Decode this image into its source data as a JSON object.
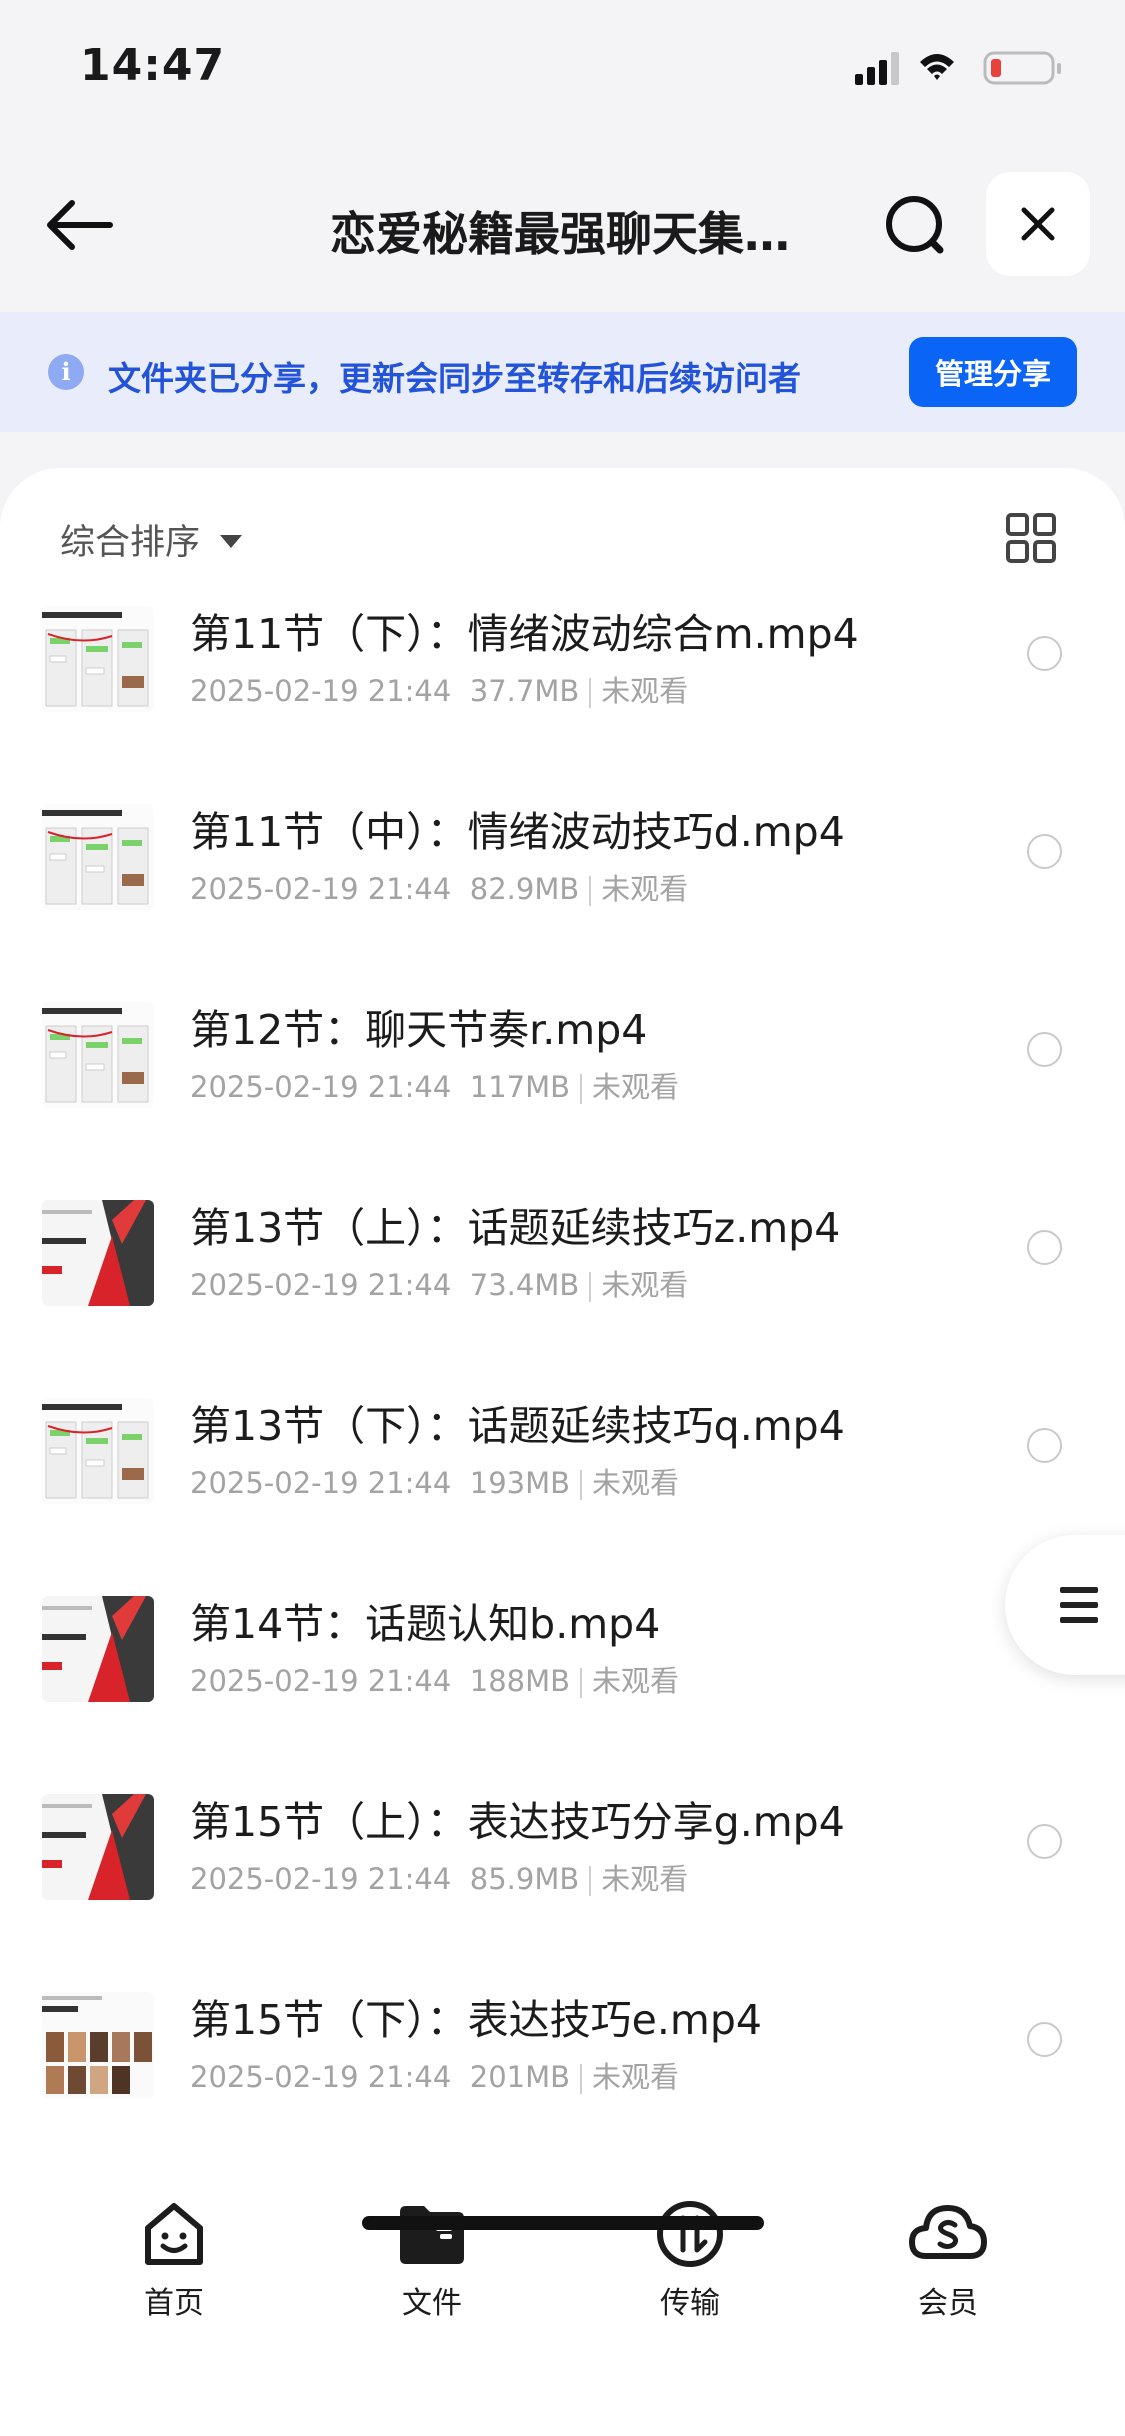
{
  "status_bar": {
    "time": "14:47",
    "icons": [
      "signal-icon",
      "wifi-icon",
      "battery-low-icon"
    ]
  },
  "nav": {
    "title": "恋爱秘籍最强聊天集…",
    "icons": [
      "arrow-left-icon",
      "search-icon",
      "close-icon"
    ]
  },
  "notice": {
    "text": "文件夹已分享，更新会同步至转存和后续访问者",
    "button": "管理分享",
    "info_glyph": "i"
  },
  "toolbar": {
    "sort_label": "综合排序",
    "icons": [
      "caret-down-icon",
      "grid-view-icon"
    ]
  },
  "files": [
    {
      "name": "第11节（下）：情绪波动综合m.mp4",
      "date": "2025-02-19 21:44",
      "size": "37.7MB",
      "status": "未观看",
      "thumb": "chat"
    },
    {
      "name": "第11节（中）：情绪波动技巧d.mp4",
      "date": "2025-02-19 21:44",
      "size": "82.9MB",
      "status": "未观看",
      "thumb": "chat"
    },
    {
      "name": "第12节：聊天节奏r.mp4",
      "date": "2025-02-19 21:44",
      "size": "117MB",
      "status": "未观看",
      "thumb": "chat"
    },
    {
      "name": "第13节（上）：话题延续技巧z.mp4",
      "date": "2025-02-19 21:44",
      "size": "73.4MB",
      "status": "未观看",
      "thumb": "cover"
    },
    {
      "name": "第13节（下）：话题延续技巧q.mp4",
      "date": "2025-02-19 21:44",
      "size": "193MB",
      "status": "未观看",
      "thumb": "chat"
    },
    {
      "name": "第14节：话题认知b.mp4",
      "date": "2025-02-19 21:44",
      "size": "188MB",
      "status": "未观看",
      "thumb": "cover"
    },
    {
      "name": "第15节（上）：表达技巧分享g.mp4",
      "date": "2025-02-19 21:44",
      "size": "85.9MB",
      "status": "未观看",
      "thumb": "cover"
    },
    {
      "name": "第15节（下）：表达技巧e.mp4",
      "date": "2025-02-19 21:44",
      "size": "201MB",
      "status": "未观看",
      "thumb": "photos"
    }
  ],
  "tabs": [
    {
      "label": "首页",
      "icon": "smiley-home-icon"
    },
    {
      "label": "文件",
      "icon": "folder-icon"
    },
    {
      "label": "传输",
      "icon": "transfer-icon"
    },
    {
      "label": "会员",
      "icon": "cloud-vip-icon"
    }
  ],
  "colors": {
    "accent": "#0a64f5",
    "notice_bg": "#e9edfb",
    "notice_text": "#2253d8",
    "battery_low": "#e8413c"
  }
}
